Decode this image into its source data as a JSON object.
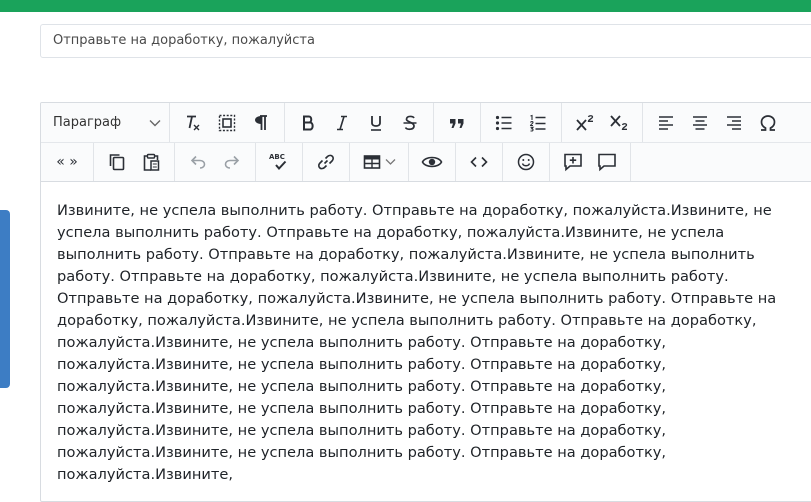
{
  "subject": {
    "value": "Отправьте на доработку, пожалуйста"
  },
  "toolbar": {
    "paragraph_label": "Параграф",
    "row1": [
      "clear-format",
      "select-all",
      "show-blocks",
      "bold",
      "italic",
      "underline",
      "strikethrough",
      "blockquote",
      "bulleted-list",
      "numbered-list",
      "superscript",
      "subscript",
      "align-left",
      "align-center",
      "align-right",
      "special-characters"
    ],
    "row2": [
      "guillemets",
      "copy",
      "paste",
      "undo",
      "redo",
      "spellcheck",
      "link",
      "table",
      "preview",
      "source-code",
      "emoji",
      "add-comment",
      "comment"
    ],
    "guillemets_label": "« »"
  },
  "content": {
    "text": "Извините, не успела выполнить работу. Отправьте на доработку, пожалуйста.Извините, не успела выполнить работу. Отправьте на доработку, пожалуйста.Извините, не успела выполнить работу. Отправьте на доработку, пожалуйста.Извините, не успела выполнить работу. Отправьте на доработку, пожалуйста.Извините, не успела выполнить работу. Отправьте на доработку, пожалуйста.Извините, не успела выполнить работу. Отправьте на доработку, пожалуйста.Извините, не успела выполнить работу. Отправьте на доработку, пожалуйста.Извините, не успела выполнить работу. Отправьте на доработку, пожалуйста.Извините, не успела выполнить работу. Отправьте на доработку, пожалуйста.Извините, не успела выполнить работу. Отправьте на доработку, пожалуйста.Извините, не успела выполнить работу. Отправьте на доработку, пожалуйста.Извините, не успела выполнить работу. Отправьте на доработку, пожалуйста.Извините, не успела выполнить работу. Отправьте на доработку, пожалуйста.Извините,"
  },
  "colors": {
    "topbar": "#1aa35b",
    "side_handle": "#3d7dc4"
  }
}
